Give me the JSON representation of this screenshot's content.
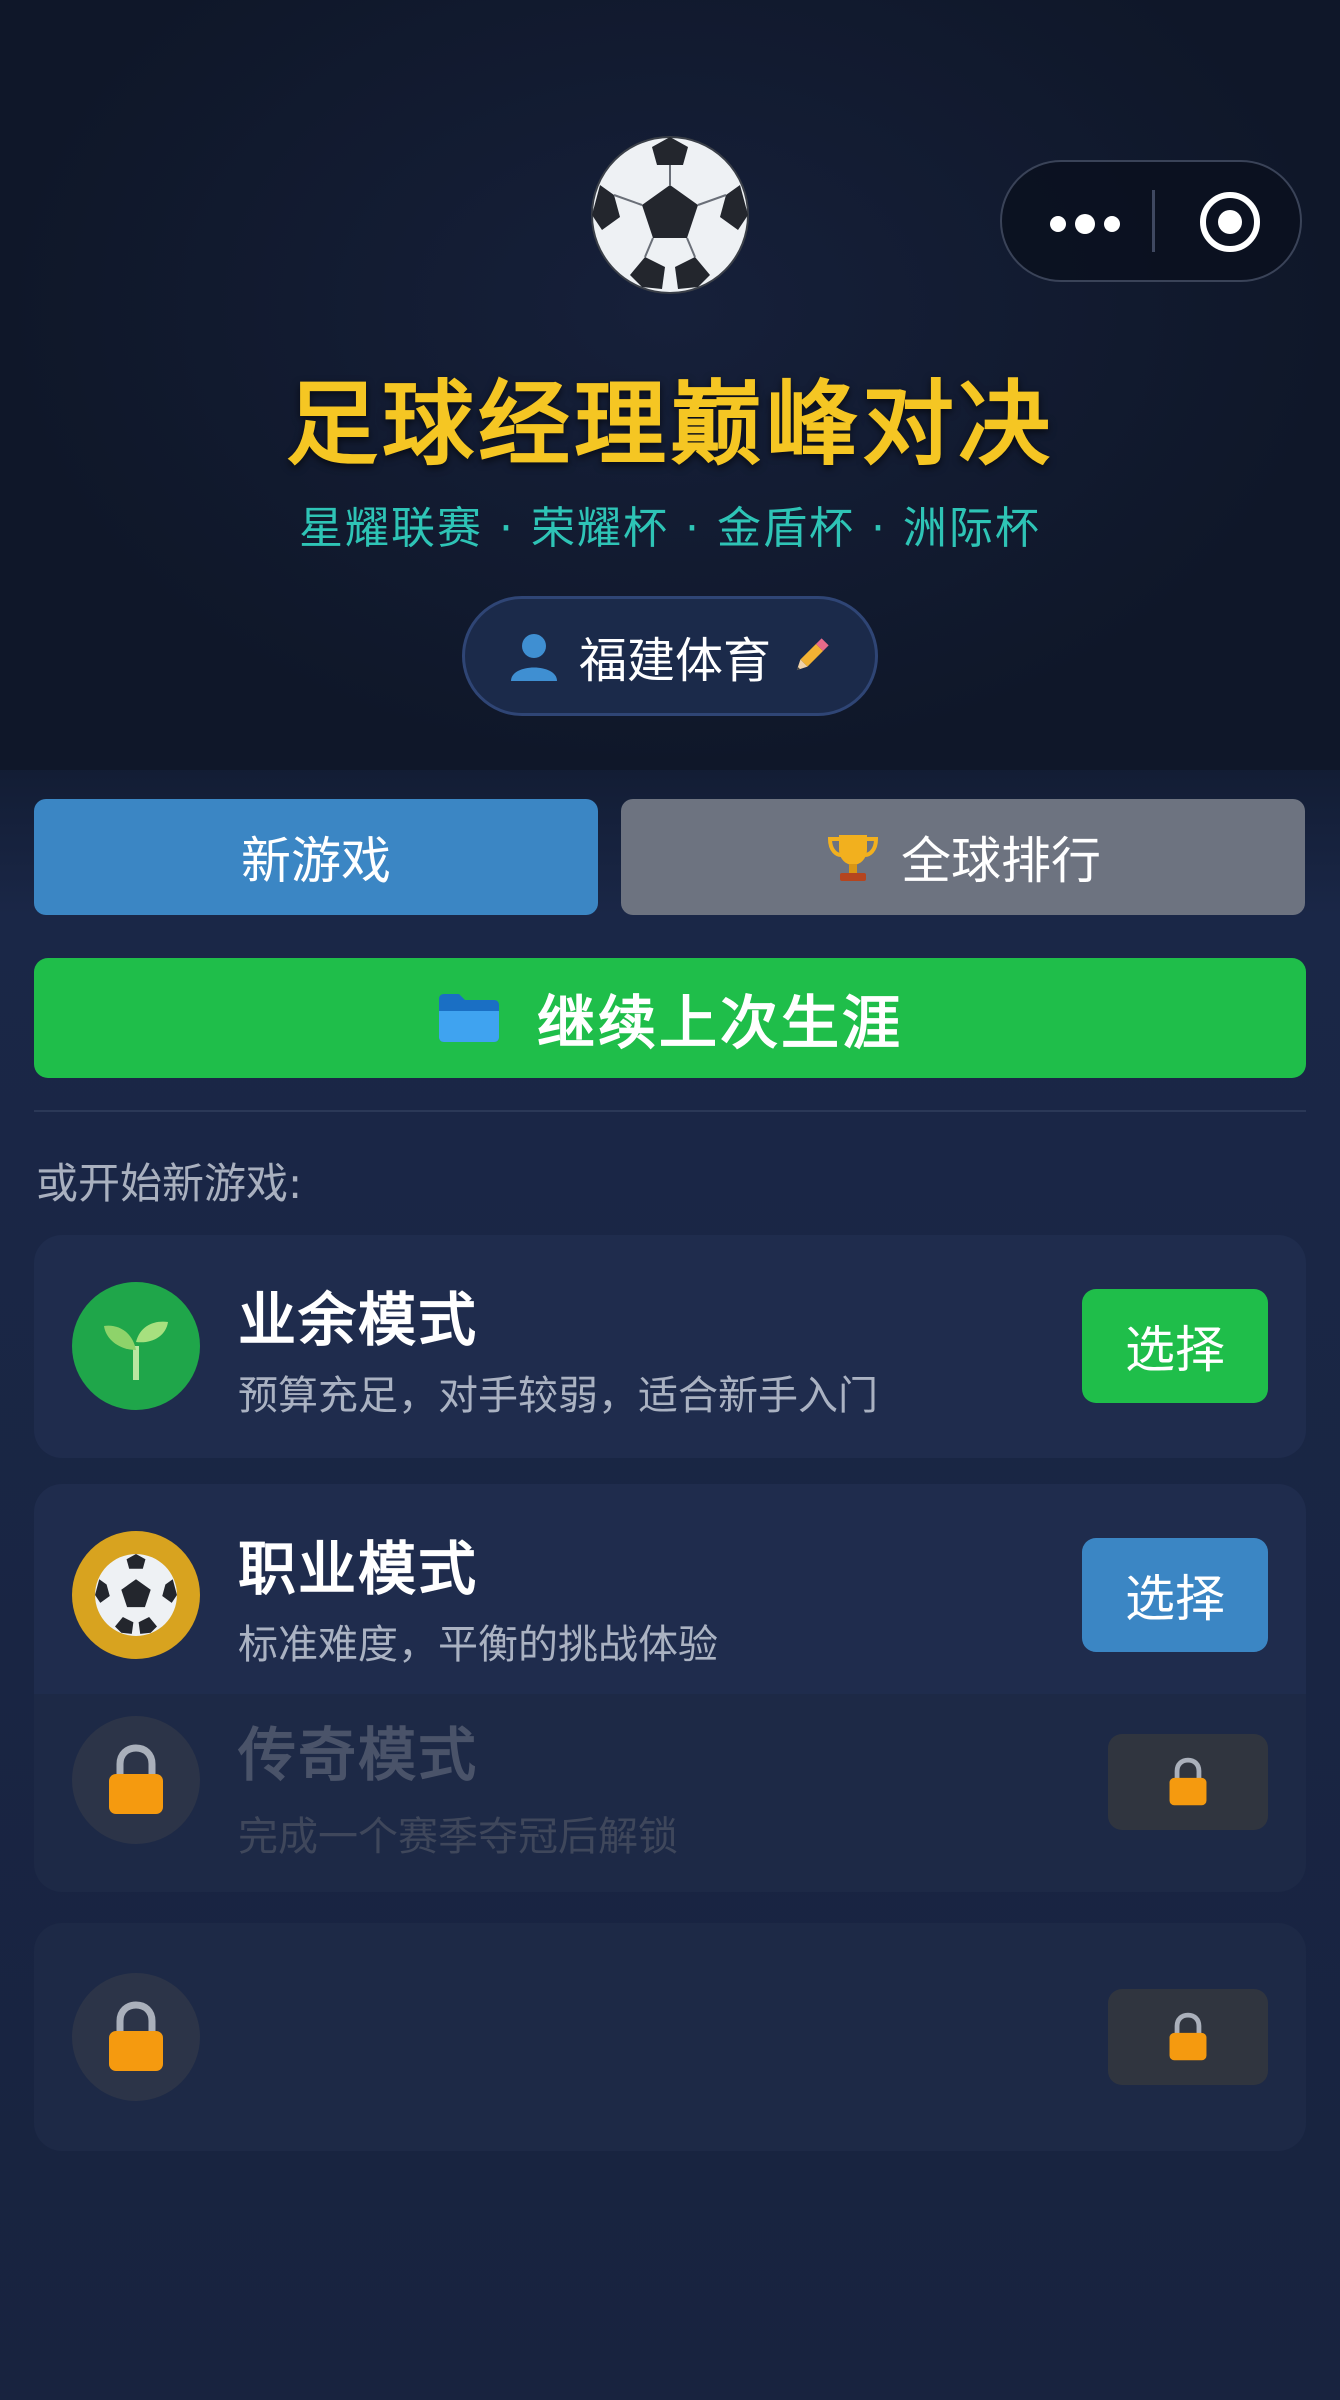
{
  "app": {
    "title": "足球经理巅峰对决",
    "subtitle": "星耀联赛 · 荣耀杯 · 金盾杯 · 洲际杯"
  },
  "capsule": {
    "more_icon": "ellipsis-icon",
    "close_icon": "target-circle-icon"
  },
  "user": {
    "name": "福建体育",
    "avatar_icon": "person-icon",
    "edit_icon": "pencil-icon"
  },
  "tabs": [
    {
      "label": "新游戏",
      "icon": ""
    },
    {
      "label": "全球排行",
      "icon": "trophy-icon"
    }
  ],
  "continue_button": {
    "label": "继续上次生涯",
    "icon": "folder-icon"
  },
  "section_label": "或开始新游戏:",
  "modes": [
    {
      "name": "业余模式",
      "desc": "预算充足，对手较弱，适合新手入门",
      "button": "选择",
      "icon": "sprout-icon",
      "locked": false
    },
    {
      "name": "职业模式",
      "desc": "标准难度，平衡的挑战体验",
      "button": "选择",
      "icon": "soccer-ball-icon",
      "locked": false
    },
    {
      "name": "传奇模式",
      "desc": "完成一个赛季夺冠后解锁",
      "button": "",
      "icon": "lock-icon",
      "locked": true
    },
    {
      "name": "",
      "desc": "",
      "button": "",
      "icon": "lock-icon",
      "locked": true
    }
  ],
  "colors": {
    "title": "#f5c623",
    "subtitle": "#2ec4b6",
    "green": "#1fbe4a",
    "blue": "#3b86c4",
    "gray_tab": "#6d7380"
  }
}
